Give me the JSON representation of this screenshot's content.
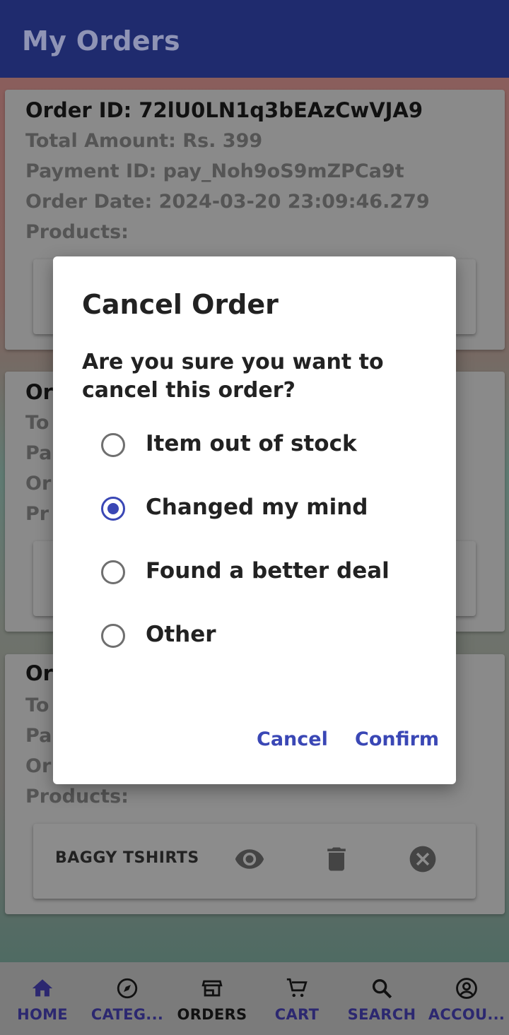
{
  "app_bar": {
    "title": "My Orders"
  },
  "orders": [
    {
      "id_line": "Order ID: 72lU0LN1q3bEAzCwVJA9",
      "amount_line": "Total Amount: Rs. 399",
      "payment_line": "Payment ID: pay_Noh9oS9mZPCa9t",
      "date_line": "Order Date: 2024-03-20 23:09:46.279",
      "products_label": "Products:"
    },
    {
      "id_line": "Or",
      "amount_line": "To",
      "payment_line": "Pa",
      "date_line": "Or",
      "products_label": "Pr"
    },
    {
      "id_line": "Or",
      "amount_line": "To",
      "payment_line": "Pa",
      "date_line": "Or",
      "products_label": "Products:",
      "product": {
        "name": "BAGGY TSHIRTS",
        "icons": [
          "eye-icon",
          "trash-icon",
          "cancel-circle-icon"
        ]
      }
    }
  ],
  "dialog": {
    "title": "Cancel Order",
    "message": "Are you sure you want to cancel this order?",
    "options": [
      {
        "label": "Item out of stock",
        "selected": false
      },
      {
        "label": "Changed my mind",
        "selected": true
      },
      {
        "label": "Found a better deal",
        "selected": false
      },
      {
        "label": "Other",
        "selected": false
      }
    ],
    "cancel_label": "Cancel",
    "confirm_label": "Confirm",
    "accent_color": "#3a47b5"
  },
  "bottom_nav": {
    "items": [
      {
        "label": "HOME",
        "icon": "home-icon"
      },
      {
        "label": "CATEG...",
        "icon": "compass-icon"
      },
      {
        "label": "ORDERS",
        "icon": "store-icon",
        "active": true
      },
      {
        "label": "CART",
        "icon": "cart-icon"
      },
      {
        "label": "SEARCH",
        "icon": "search-icon"
      },
      {
        "label": "ACCOU...",
        "icon": "account-icon"
      }
    ]
  },
  "colors": {
    "app_bar": "#1f2b6e",
    "nav_label": "#2c2870"
  }
}
